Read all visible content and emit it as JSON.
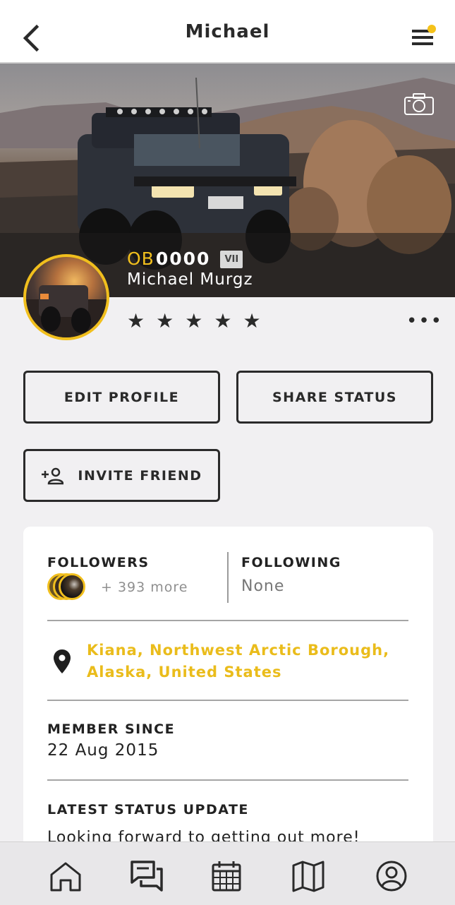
{
  "header": {
    "title": "Michael",
    "back_icon": "chevron-left-icon",
    "menu_icon": "hamburger-menu-icon",
    "notification_dot_color": "#f5c21a"
  },
  "cover": {
    "camera_icon": "camera-icon",
    "ob_prefix": "OB",
    "ob_number": "0000",
    "rank_badge": "VII",
    "full_name": "Michael Murgz"
  },
  "rating": {
    "stars": 5,
    "star_glyphs": [
      "★",
      "★",
      "★",
      "★",
      "★"
    ],
    "more_label": "•••"
  },
  "actions": {
    "edit_profile": "EDIT PROFILE",
    "share_status": "SHARE STATUS",
    "invite_friend": "INVITE FRIEND",
    "invite_icon": "add-person-icon"
  },
  "social": {
    "followers_label": "FOLLOWERS",
    "followers_more": "+ 393 more",
    "following_label": "FOLLOWING",
    "following_value": "None"
  },
  "location": {
    "icon": "location-pin-icon",
    "text": "Kiana, Northwest Arctic Borough, Alaska, United States"
  },
  "member": {
    "label": "MEMBER SINCE",
    "date": "22 Aug 2015"
  },
  "status": {
    "label": "LATEST STATUS UPDATE",
    "text": "Looking forward to getting out more!"
  },
  "bottom_nav": {
    "items": [
      "home-icon",
      "chat-icon",
      "calendar-icon",
      "map-icon",
      "profile-icon"
    ]
  },
  "colors": {
    "accent": "#f1bf1d",
    "location_text": "#eabc1b",
    "dark": "#2a2a2a"
  }
}
